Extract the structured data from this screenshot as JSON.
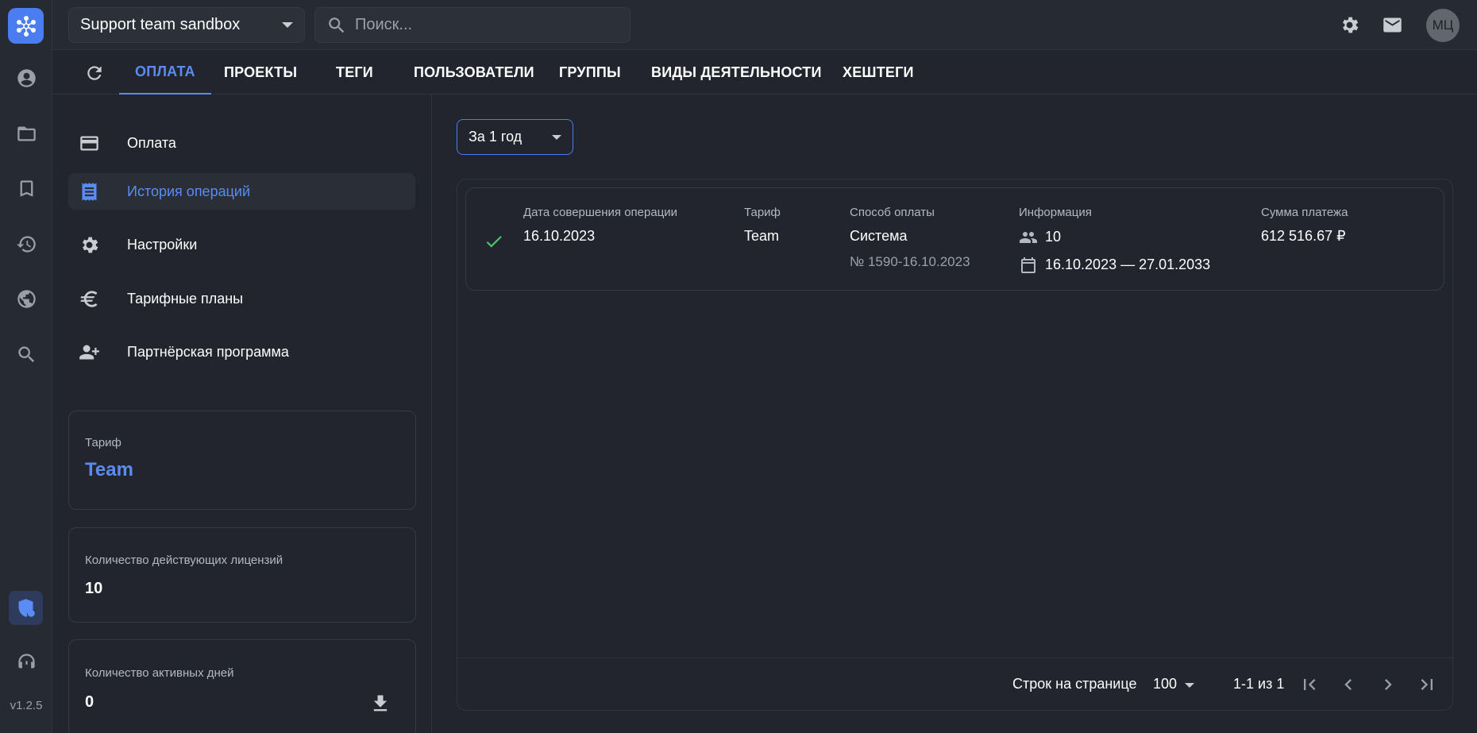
{
  "workspace": {
    "name": "Support team sandbox"
  },
  "search": {
    "placeholder": "Поиск..."
  },
  "user": {
    "initials": "МЦ"
  },
  "version": "v1.2.5",
  "tabs": [
    {
      "label": "ОПЛАТА",
      "active": true
    },
    {
      "label": "ПРОЕКТЫ"
    },
    {
      "label": "ТЕГИ"
    },
    {
      "label": "ПОЛЬЗОВАТЕЛИ"
    },
    {
      "label": "ГРУППЫ"
    },
    {
      "label": "ВИДЫ ДЕЯТЕЛЬНОСТИ"
    },
    {
      "label": "ХЕШТЕГИ"
    }
  ],
  "menu": {
    "items": [
      {
        "label": "Оплата",
        "icon": "credit-card-icon"
      },
      {
        "label": "История операций",
        "icon": "receipt-icon",
        "active": true
      },
      {
        "label": "Настройки",
        "icon": "gear-icon"
      },
      {
        "label": "Тарифные планы",
        "icon": "euro-icon"
      },
      {
        "label": "Партнёрская программа",
        "icon": "add-user-icon"
      }
    ]
  },
  "cards": {
    "tariff": {
      "label": "Тариф",
      "value": "Team"
    },
    "licenses": {
      "label": "Количество действующих лицензий",
      "value": "10"
    },
    "active_days": {
      "label": "Количество активных дней",
      "value": "0"
    }
  },
  "filter": {
    "period": "За 1 год"
  },
  "table": {
    "columns": {
      "date": "Дата совершения операции",
      "tariff": "Тариф",
      "method": "Способ оплаты",
      "info": "Информация",
      "amount": "Сумма платежа"
    },
    "rows": [
      {
        "status": "success",
        "date": "16.10.2023",
        "tariff": "Team",
        "method": "Система",
        "method_ref": "№ 1590-16.10.2023",
        "users": "10",
        "period": "16.10.2023 — 27.01.2033",
        "amount": "612 516.67 ₽"
      }
    ]
  },
  "pagination": {
    "rows_label": "Строк на странице",
    "rows_per_page": "100",
    "range": "1-1 из 1"
  },
  "colors": {
    "accent": "#5b8cf6",
    "success": "#4fc36b",
    "background": "#22252d"
  }
}
